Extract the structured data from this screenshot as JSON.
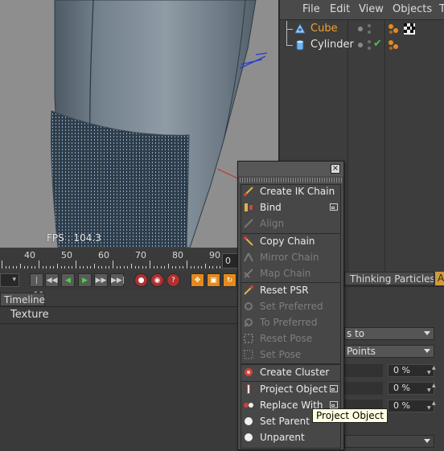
{
  "viewport": {
    "fps_text": "FPS : 104.3"
  },
  "object_manager": {
    "menu": [
      "File",
      "Edit",
      "View",
      "Objects",
      "T"
    ],
    "objects": [
      {
        "name": "Cube",
        "color": "#f0a22b",
        "icon": "cube-icon",
        "selected": true
      },
      {
        "name": "Cylinder",
        "color": "#e6e6e6",
        "icon": "cylinder-icon",
        "selected": false
      }
    ]
  },
  "timeline": {
    "ruler_labels": [
      "40",
      "50",
      "60",
      "70",
      "80",
      "90"
    ],
    "frame_value": "0",
    "tab_label": "Timeline",
    "track_label": "Texture"
  },
  "attributes": {
    "tab_thinking": "Thinking Particles",
    "tab_a": "A",
    "dropdown1_value": "s to",
    "dropdown2_value": "Points",
    "field_values": [
      "0 %",
      "0 %",
      "0 %"
    ]
  },
  "palette": {
    "close_label": "×",
    "groups": [
      {
        "items": [
          {
            "label": "Create IK Chain",
            "icon": "ik-chain-icon",
            "enabled": true,
            "submenu": false
          },
          {
            "label": "Bind",
            "icon": "bind-icon",
            "enabled": true,
            "submenu": true
          },
          {
            "label": "Align",
            "icon": "align-icon",
            "enabled": false,
            "submenu": false
          }
        ]
      },
      {
        "items": [
          {
            "label": "Copy Chain",
            "icon": "copy-chain-icon",
            "enabled": true,
            "submenu": false
          },
          {
            "label": "Mirror Chain",
            "icon": "mirror-chain-icon",
            "enabled": false,
            "submenu": false
          },
          {
            "label": "Map Chain",
            "icon": "map-chain-icon",
            "enabled": false,
            "submenu": false
          }
        ]
      },
      {
        "items": [
          {
            "label": "Reset PSR",
            "icon": "reset-psr-icon",
            "enabled": true,
            "submenu": false
          },
          {
            "label": "Set Preferred",
            "icon": "set-preferred-icon",
            "enabled": false,
            "submenu": false
          },
          {
            "label": "To Preferred",
            "icon": "to-preferred-icon",
            "enabled": false,
            "submenu": false
          },
          {
            "label": "Reset Pose",
            "icon": "reset-pose-icon",
            "enabled": false,
            "submenu": false
          },
          {
            "label": "Set Pose",
            "icon": "set-pose-icon",
            "enabled": false,
            "submenu": false
          }
        ]
      },
      {
        "items": [
          {
            "label": "Create Cluster",
            "icon": "cluster-icon",
            "enabled": true,
            "submenu": false
          }
        ]
      },
      {
        "items": [
          {
            "label": "Project Object",
            "icon": "project-object-icon",
            "enabled": true,
            "submenu": true
          },
          {
            "label": "Replace With",
            "icon": "replace-with-icon",
            "enabled": true,
            "submenu": true
          },
          {
            "label": "Set Parent",
            "icon": "set-parent-icon",
            "enabled": true,
            "submenu": false
          },
          {
            "label": "Unparent",
            "icon": "unparent-icon",
            "enabled": true,
            "submenu": false
          }
        ]
      }
    ]
  },
  "tooltip": {
    "text": "Project Object"
  },
  "colors": {
    "accent_orange": "#f0a22b",
    "active_tab": "#cf9a3c",
    "panel_bg": "#3c3c3c"
  }
}
